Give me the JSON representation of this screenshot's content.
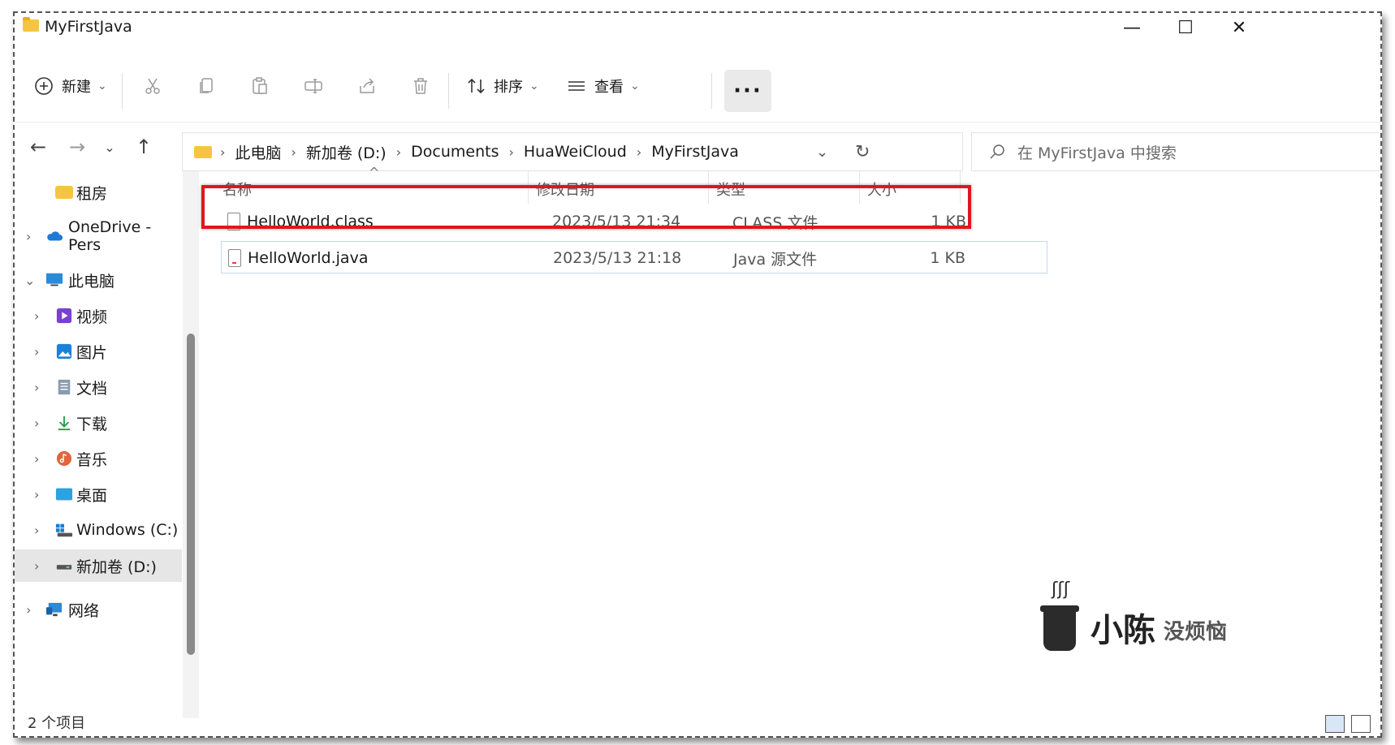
{
  "window": {
    "title": "MyFirstJava",
    "minimize_glyph": "—",
    "maximize_glyph": "☐",
    "close_glyph": "✕"
  },
  "toolbar": {
    "new_label": "新建",
    "sort_label": "排序",
    "view_label": "查看",
    "more_label": "···",
    "dropdown_glyph": "⌄",
    "icons": [
      "cut-icon",
      "copy-icon",
      "paste-icon",
      "rename-icon",
      "share-icon",
      "delete-icon"
    ]
  },
  "nav": {
    "back_glyph": "←",
    "forward_glyph": "→",
    "recent_glyph": "⌄",
    "up_glyph": "↑",
    "breadcrumb": [
      "此电脑",
      "新加卷 (D:)",
      "Documents",
      "HuaWeiCloud",
      "MyFirstJava"
    ],
    "sep_glyph": "›",
    "expand_glyph": "⌄",
    "refresh_glyph": "↻",
    "search_placeholder": "在 MyFirstJava 中搜索",
    "search_glyph": "⌕"
  },
  "sidebar": {
    "items": [
      {
        "label": "租房"
      },
      {
        "label": "OneDrive - Pers"
      },
      {
        "label": "此电脑"
      },
      {
        "label": "视频"
      },
      {
        "label": "图片"
      },
      {
        "label": "文档"
      },
      {
        "label": "下载"
      },
      {
        "label": "音乐"
      },
      {
        "label": "桌面"
      },
      {
        "label": "Windows (C:)"
      },
      {
        "label": "新加卷 (D:)"
      },
      {
        "label": "网络"
      }
    ],
    "chev_right": "›",
    "chev_down": "⌄"
  },
  "columns": {
    "name": "名称",
    "modified": "修改日期",
    "type": "类型",
    "size": "大小",
    "sort_glyph": "^"
  },
  "files": [
    {
      "name": "HelloWorld.class",
      "modified": "2023/5/13 21:34",
      "type": "CLASS 文件",
      "size": "1 KB"
    },
    {
      "name": "HelloWorld.java",
      "modified": "2023/5/13 21:18",
      "type": "Java 源文件",
      "size": "1 KB"
    }
  ],
  "status": {
    "count": "2 个项目"
  },
  "watermark": {
    "steam": "ʃʃʃ",
    "name": "小陈",
    "sub": "没烦恼"
  },
  "colors": {
    "highlight_box": "#e0161b",
    "selection_border": "#c6d8ef",
    "folder": "#f5c542"
  }
}
